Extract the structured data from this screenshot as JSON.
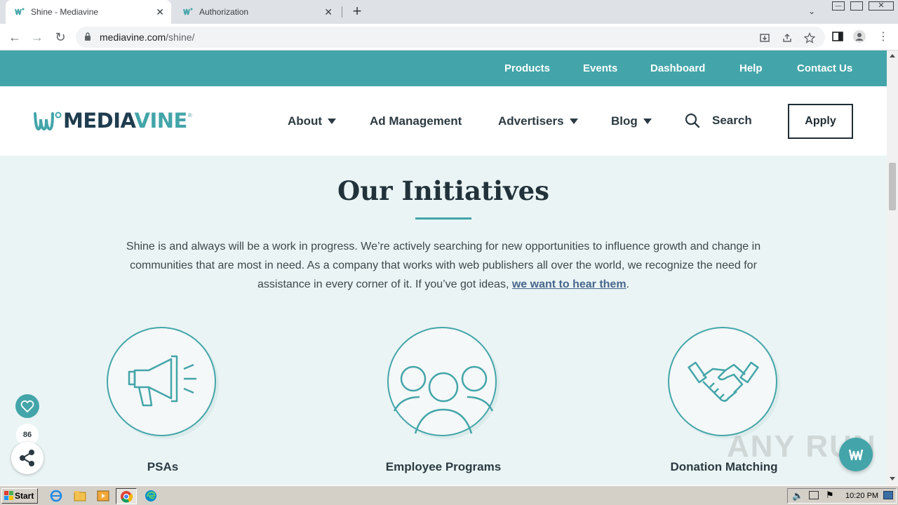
{
  "browser": {
    "tabs": [
      {
        "title": "Shine - Mediavine",
        "active": true
      },
      {
        "title": "Authorization",
        "active": false
      }
    ],
    "url_host": "mediavine.com",
    "url_path": "/shine/"
  },
  "topnav": {
    "items": [
      "Products",
      "Events",
      "Dashboard",
      "Help",
      "Contact Us"
    ]
  },
  "mainnav": {
    "logo_text_1": "MEDIA",
    "logo_text_2": "VINE",
    "items": [
      {
        "label": "About",
        "has_dropdown": true
      },
      {
        "label": "Ad Management",
        "has_dropdown": false
      },
      {
        "label": "Advertisers",
        "has_dropdown": true
      },
      {
        "label": "Blog",
        "has_dropdown": true
      }
    ],
    "search_label": "Search",
    "apply_label": "Apply"
  },
  "content": {
    "title": "Our Initiatives",
    "intro_text": "Shine is and always will be a work in progress. We’re actively searching for new opportunities to influence growth and change in communities that are most in need. As a company that works with web publishers all over the world, we recognize the need for assistance in every corner of it. If you’ve got ideas, ",
    "intro_link": "we want to hear them",
    "intro_end": ".",
    "initiatives": [
      {
        "label": "PSAs",
        "icon": "megaphone-icon"
      },
      {
        "label": "Employee Programs",
        "icon": "people-icon"
      },
      {
        "label": "Donation Matching",
        "icon": "handshake-icon"
      }
    ]
  },
  "floating": {
    "like_count": "86",
    "watermark": "ANY RUN"
  },
  "taskbar": {
    "start_label": "Start",
    "clock": "10:20 PM"
  },
  "colors": {
    "teal": "#43a5a9",
    "navy": "#1f3d4f",
    "page_bg": "#eaf4f4"
  }
}
